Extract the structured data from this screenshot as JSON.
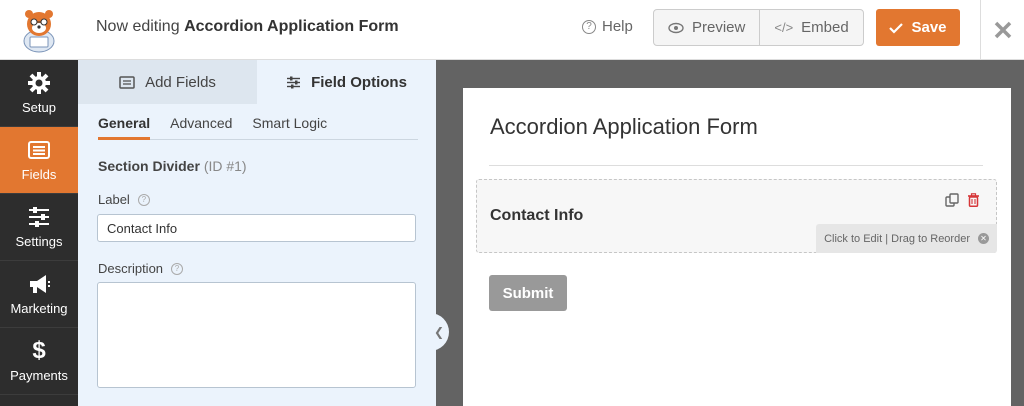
{
  "header": {
    "editing_prefix": "Now editing",
    "form_name": "Accordion Application Form",
    "help_label": "Help",
    "preview_label": "Preview",
    "embed_label": "Embed",
    "save_label": "Save"
  },
  "sidebar": {
    "items": [
      {
        "label": "Setup",
        "icon": "gear-icon"
      },
      {
        "label": "Fields",
        "icon": "fields-icon",
        "active": true
      },
      {
        "label": "Settings",
        "icon": "sliders-icon"
      },
      {
        "label": "Marketing",
        "icon": "megaphone-icon"
      },
      {
        "label": "Payments",
        "icon": "dollar-icon"
      }
    ]
  },
  "panel": {
    "tabs": [
      {
        "label": "Add Fields"
      },
      {
        "label": "Field Options",
        "active": true
      }
    ],
    "subtabs": [
      {
        "label": "General",
        "active": true
      },
      {
        "label": "Advanced"
      },
      {
        "label": "Smart Logic"
      }
    ],
    "section_title": "Section Divider",
    "section_id": "(ID #1)",
    "label_caption": "Label",
    "label_value": "Contact Info",
    "description_caption": "Description",
    "description_value": ""
  },
  "preview": {
    "form_title": "Accordion Application Form",
    "field_label": "Contact Info",
    "field_hint": "Click to Edit | Drag to Reorder",
    "submit_label": "Submit"
  },
  "colors": {
    "accent": "#e27730",
    "sidebar_bg": "#2d2d2d",
    "panel_bg": "#ebf3fc",
    "preview_bg": "#636363"
  }
}
